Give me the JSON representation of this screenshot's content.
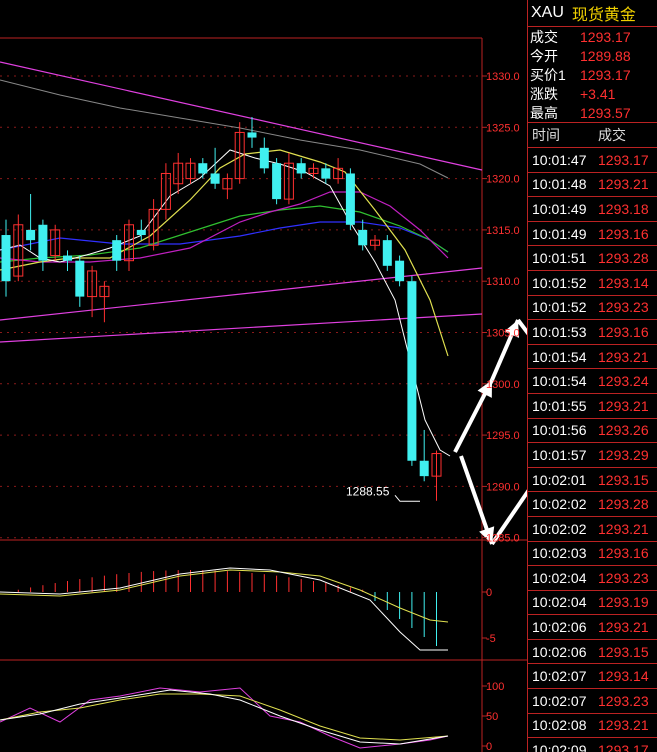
{
  "header": {
    "symbol": "XAU",
    "name": "现货黄金"
  },
  "quote": [
    {
      "label": "成交",
      "value": "1293.17"
    },
    {
      "label": "今开",
      "value": "1289.88"
    },
    {
      "label": "买价1",
      "value": "1293.17"
    },
    {
      "label": "涨跌",
      "value": "+3.41"
    },
    {
      "label": "最高",
      "value": "1293.57"
    }
  ],
  "ticks_header": {
    "time": "时间",
    "price": "成交"
  },
  "ticks": [
    {
      "time": "10:01:47",
      "price": "1293.17"
    },
    {
      "time": "10:01:48",
      "price": "1293.21"
    },
    {
      "time": "10:01:49",
      "price": "1293.18"
    },
    {
      "time": "10:01:49",
      "price": "1293.16"
    },
    {
      "time": "10:01:51",
      "price": "1293.28"
    },
    {
      "time": "10:01:52",
      "price": "1293.14"
    },
    {
      "time": "10:01:52",
      "price": "1293.23"
    },
    {
      "time": "10:01:53",
      "price": "1293.16"
    },
    {
      "time": "10:01:54",
      "price": "1293.21"
    },
    {
      "time": "10:01:54",
      "price": "1293.24"
    },
    {
      "time": "10:01:55",
      "price": "1293.21"
    },
    {
      "time": "10:01:56",
      "price": "1293.26"
    },
    {
      "time": "10:01:57",
      "price": "1293.29"
    },
    {
      "time": "10:02:01",
      "price": "1293.15"
    },
    {
      "time": "10:02:02",
      "price": "1293.28"
    },
    {
      "time": "10:02:02",
      "price": "1293.21"
    },
    {
      "time": "10:02:03",
      "price": "1293.16"
    },
    {
      "time": "10:02:04",
      "price": "1293.23"
    },
    {
      "time": "10:02:04",
      "price": "1293.19"
    },
    {
      "time": "10:02:06",
      "price": "1293.21"
    },
    {
      "time": "10:02:06",
      "price": "1293.15"
    },
    {
      "time": "10:02:07",
      "price": "1293.14"
    },
    {
      "time": "10:02:07",
      "price": "1293.23"
    },
    {
      "time": "10:02:08",
      "price": "1293.21"
    },
    {
      "time": "10:02:09",
      "price": "1293.17"
    }
  ],
  "chart_data": {
    "type": "candlestick",
    "price_axis": {
      "ticks": [
        "1330.0",
        "1325.0",
        "1320.0",
        "1315.0",
        "1310.0",
        "1305.0",
        "1300.0",
        "1295.0",
        "1290.0",
        "1285.0"
      ],
      "range": [
        1284,
        1334
      ]
    },
    "low_annotation": "1288.55",
    "macd_axis": {
      "ticks": [
        "0",
        "-5"
      ]
    },
    "kdj_axis": {
      "ticks": [
        "100",
        "50",
        "0"
      ]
    },
    "candles": [
      {
        "o": 1314.5,
        "h": 1316.0,
        "l": 1308.5,
        "c": 1310.0
      },
      {
        "o": 1310.5,
        "h": 1316.5,
        "l": 1310.0,
        "c": 1315.5
      },
      {
        "o": 1315.0,
        "h": 1318.5,
        "l": 1313.0,
        "c": 1314.0
      },
      {
        "o": 1315.5,
        "h": 1316.0,
        "l": 1311.0,
        "c": 1312.0
      },
      {
        "o": 1312.5,
        "h": 1315.5,
        "l": 1312.0,
        "c": 1315.0
      },
      {
        "o": 1312.5,
        "h": 1313.0,
        "l": 1311.0,
        "c": 1312.0
      },
      {
        "o": 1312.0,
        "h": 1312.5,
        "l": 1307.5,
        "c": 1308.5
      },
      {
        "o": 1308.5,
        "h": 1311.5,
        "l": 1306.5,
        "c": 1311.0
      },
      {
        "o": 1308.5,
        "h": 1310.0,
        "l": 1306.0,
        "c": 1309.5
      },
      {
        "o": 1314.0,
        "h": 1314.5,
        "l": 1311.0,
        "c": 1312.0
      },
      {
        "o": 1312.0,
        "h": 1316.0,
        "l": 1311.0,
        "c": 1315.5
      },
      {
        "o": 1315.0,
        "h": 1316.0,
        "l": 1314.0,
        "c": 1314.5
      },
      {
        "o": 1313.5,
        "h": 1318.0,
        "l": 1313.0,
        "c": 1317.0
      },
      {
        "o": 1317.0,
        "h": 1321.5,
        "l": 1316.0,
        "c": 1320.5
      },
      {
        "o": 1319.5,
        "h": 1322.5,
        "l": 1318.5,
        "c": 1321.5
      },
      {
        "o": 1320.0,
        "h": 1322.0,
        "l": 1319.5,
        "c": 1321.5
      },
      {
        "o": 1321.5,
        "h": 1322.0,
        "l": 1320.0,
        "c": 1320.5
      },
      {
        "o": 1320.5,
        "h": 1323.0,
        "l": 1319.0,
        "c": 1319.5
      },
      {
        "o": 1319.0,
        "h": 1320.5,
        "l": 1318.0,
        "c": 1320.0
      },
      {
        "o": 1320.0,
        "h": 1325.5,
        "l": 1319.5,
        "c": 1324.5
      },
      {
        "o": 1324.5,
        "h": 1326.0,
        "l": 1323.0,
        "c": 1324.0
      },
      {
        "o": 1323.0,
        "h": 1324.0,
        "l": 1320.5,
        "c": 1321.0
      },
      {
        "o": 1321.5,
        "h": 1322.0,
        "l": 1317.5,
        "c": 1318.0
      },
      {
        "o": 1318.0,
        "h": 1322.5,
        "l": 1317.5,
        "c": 1321.5
      },
      {
        "o": 1321.5,
        "h": 1322.0,
        "l": 1320.0,
        "c": 1320.5
      },
      {
        "o": 1320.5,
        "h": 1321.5,
        "l": 1320.0,
        "c": 1321.0
      },
      {
        "o": 1321.0,
        "h": 1321.5,
        "l": 1319.5,
        "c": 1320.0
      },
      {
        "o": 1320.0,
        "h": 1322.0,
        "l": 1319.5,
        "c": 1321.0
      },
      {
        "o": 1320.5,
        "h": 1321.0,
        "l": 1315.0,
        "c": 1315.5
      },
      {
        "o": 1315.0,
        "h": 1316.0,
        "l": 1313.0,
        "c": 1313.5
      },
      {
        "o": 1313.5,
        "h": 1314.5,
        "l": 1313.0,
        "c": 1314.0
      },
      {
        "o": 1314.0,
        "h": 1314.5,
        "l": 1311.0,
        "c": 1311.5
      },
      {
        "o": 1312.0,
        "h": 1312.5,
        "l": 1309.5,
        "c": 1310.0
      },
      {
        "o": 1310.0,
        "h": 1310.5,
        "l": 1292.0,
        "c": 1292.5
      },
      {
        "o": 1292.5,
        "h": 1295.5,
        "l": 1290.5,
        "c": 1291.0
      },
      {
        "o": 1291.0,
        "h": 1293.5,
        "l": 1288.6,
        "c": 1293.2
      }
    ]
  }
}
